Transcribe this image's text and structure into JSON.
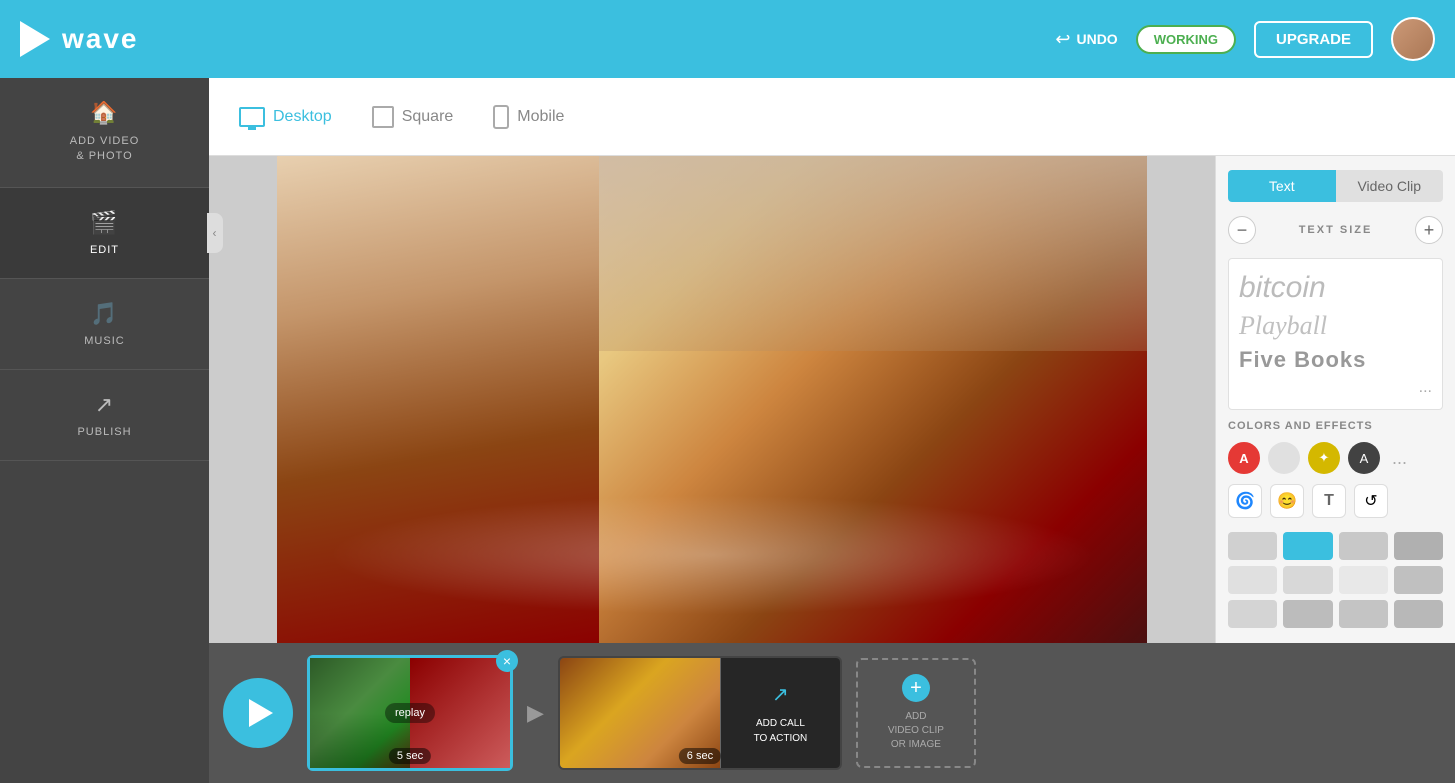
{
  "header": {
    "logo_text": "wave",
    "undo_label": "UNDO",
    "working_label": "WORKING",
    "upgrade_label": "UPGRADE"
  },
  "toolbar": {
    "views": [
      {
        "id": "desktop",
        "label": "Desktop",
        "active": true
      },
      {
        "id": "square",
        "label": "Square",
        "active": false
      },
      {
        "id": "mobile",
        "label": "Mobile",
        "active": false
      }
    ]
  },
  "sidebar": {
    "items": [
      {
        "id": "add-video",
        "label": "ADD VIDEO\n& PHOTO",
        "icon": "🏠"
      },
      {
        "id": "edit",
        "label": "EDIT",
        "icon": "🎬",
        "active": true
      },
      {
        "id": "music",
        "label": "MUSIC",
        "icon": "🎵"
      },
      {
        "id": "publish",
        "label": "PUBLISH",
        "icon": "↗"
      }
    ]
  },
  "right_panel": {
    "tabs": [
      {
        "id": "text",
        "label": "Text",
        "active": true
      },
      {
        "id": "video-clip",
        "label": "Video Clip",
        "active": false
      }
    ],
    "text_size_label": "TEXT SIZE",
    "fonts": [
      {
        "id": "bitcoin",
        "name": "bitcoin",
        "style": "sans-light"
      },
      {
        "id": "playball",
        "name": "Playball",
        "style": "cursive"
      },
      {
        "id": "fivebooks",
        "name": "Five Books",
        "style": "bold"
      }
    ],
    "more_label": "...",
    "colors_section_label": "COLORS AND EFFECTS",
    "colors": [
      {
        "id": "red",
        "hex": "#e53935",
        "label": "A",
        "selected": true
      },
      {
        "id": "light-gray",
        "hex": "#e0e0e0",
        "label": ""
      },
      {
        "id": "gold",
        "hex": "#d4b800",
        "label": "✦"
      },
      {
        "id": "dark",
        "hex": "#424242",
        "label": "A"
      }
    ],
    "effects": [
      {
        "id": "spiral",
        "icon": "🌀"
      },
      {
        "id": "face",
        "icon": "😊"
      },
      {
        "id": "text-effect",
        "icon": "T"
      },
      {
        "id": "arrow",
        "icon": "↺"
      }
    ]
  },
  "timeline": {
    "clips": [
      {
        "id": "clip1",
        "duration": "5 sec",
        "selected": true,
        "label": "replay"
      },
      {
        "id": "clip2",
        "duration": "6 sec",
        "selected": false,
        "cta": "ADD CALL\nTO ACTION"
      }
    ],
    "add_label": "ADD\nVIDEO CLIP\nOR IMAGE"
  },
  "colors": {
    "accent": "#3bbfdf",
    "sidebar_bg": "#444444",
    "active_tab": "#3bbfdf"
  }
}
